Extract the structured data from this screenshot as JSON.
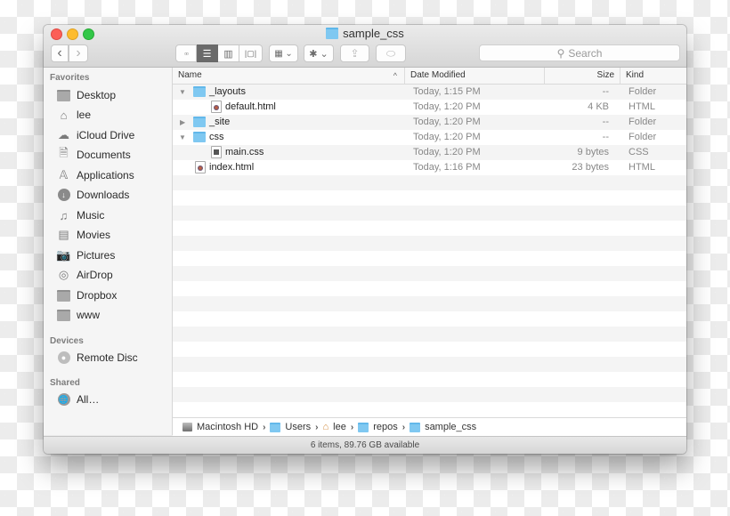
{
  "window": {
    "title": "sample_css",
    "title_icon": "folder-icon"
  },
  "toolbar": {
    "back_icon": "‹",
    "forward_icon": "›",
    "view_modes": [
      {
        "name": "icon-view",
        "glyph": "▫▫",
        "active": false
      },
      {
        "name": "list-view",
        "glyph": "☰",
        "active": true
      },
      {
        "name": "column-view",
        "glyph": "▥",
        "active": false
      },
      {
        "name": "cover-flow-view",
        "glyph": "|▢|",
        "active": false
      }
    ],
    "arrange_glyph": "▦ ⌄",
    "action_glyph": "✱ ⌄",
    "share_glyph": "⇪",
    "tags_glyph": "⬭",
    "search_placeholder": "Search"
  },
  "sidebar": {
    "sections": [
      {
        "heading": "Favorites",
        "items": [
          {
            "label": "Desktop",
            "icon": "desktop-icon"
          },
          {
            "label": "lee",
            "icon": "home-icon"
          },
          {
            "label": "iCloud Drive",
            "icon": "cloud-icon"
          },
          {
            "label": "Documents",
            "icon": "documents-icon"
          },
          {
            "label": "Applications",
            "icon": "applications-icon"
          },
          {
            "label": "Downloads",
            "icon": "downloads-icon"
          },
          {
            "label": "Music",
            "icon": "music-icon"
          },
          {
            "label": "Movies",
            "icon": "movies-icon"
          },
          {
            "label": "Pictures",
            "icon": "pictures-icon"
          },
          {
            "label": "AirDrop",
            "icon": "airdrop-icon"
          },
          {
            "label": "Dropbox",
            "icon": "folder-icon"
          },
          {
            "label": "www",
            "icon": "folder-icon"
          }
        ]
      },
      {
        "heading": "Devices",
        "items": [
          {
            "label": "Remote Disc",
            "icon": "disc-icon"
          }
        ]
      },
      {
        "heading": "Shared",
        "items": [
          {
            "label": "All…",
            "icon": "network-icon"
          }
        ]
      }
    ]
  },
  "columns": {
    "name": "Name",
    "date": "Date Modified",
    "size": "Size",
    "kind": "Kind",
    "sort_indicator": "^"
  },
  "files": [
    {
      "name": "_layouts",
      "date": "Today, 1:15 PM",
      "size": "--",
      "kind": "Folder",
      "type": "folder",
      "depth": 0,
      "disclosure": "expanded"
    },
    {
      "name": "default.html",
      "date": "Today, 1:20 PM",
      "size": "4 KB",
      "kind": "HTML",
      "type": "html",
      "depth": 1,
      "disclosure": "none"
    },
    {
      "name": "_site",
      "date": "Today, 1:20 PM",
      "size": "--",
      "kind": "Folder",
      "type": "folder",
      "depth": 0,
      "disclosure": "collapsed"
    },
    {
      "name": "css",
      "date": "Today, 1:20 PM",
      "size": "--",
      "kind": "Folder",
      "type": "folder",
      "depth": 0,
      "disclosure": "expanded"
    },
    {
      "name": "main.css",
      "date": "Today, 1:20 PM",
      "size": "9 bytes",
      "kind": "CSS",
      "type": "css",
      "depth": 1,
      "disclosure": "none"
    },
    {
      "name": "index.html",
      "date": "Today, 1:16 PM",
      "size": "23 bytes",
      "kind": "HTML",
      "type": "html",
      "depth": 0,
      "disclosure": "none"
    }
  ],
  "pathbar": [
    {
      "label": "Macintosh HD",
      "icon": "hard-drive-icon"
    },
    {
      "label": "Users",
      "icon": "folder-icon"
    },
    {
      "label": "lee",
      "icon": "home-icon"
    },
    {
      "label": "repos",
      "icon": "folder-icon"
    },
    {
      "label": "sample_css",
      "icon": "folder-icon"
    }
  ],
  "pathbar_separator": "›",
  "status": "6 items, 89.76 GB available"
}
